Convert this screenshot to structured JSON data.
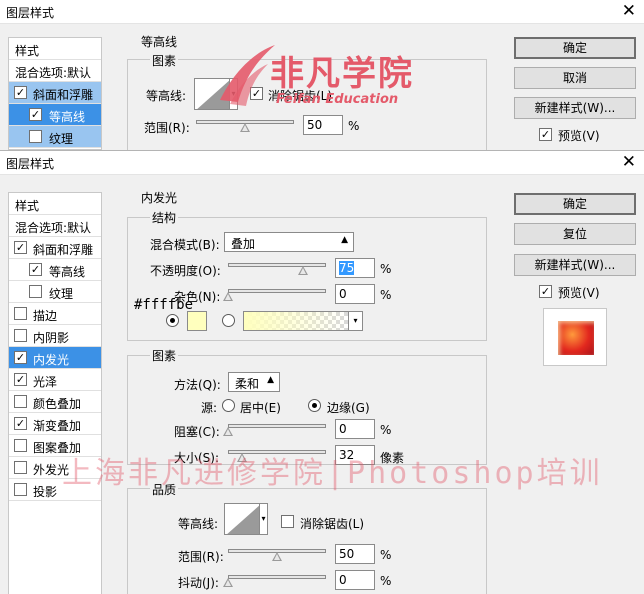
{
  "back_dialog": {
    "title": "图层样式",
    "left_items": [
      {
        "label": "样式"
      },
      {
        "label": "混合选项:默认"
      },
      {
        "label": "斜面和浮雕",
        "checked": "✓"
      },
      {
        "label": "等高线",
        "checked": "✓"
      },
      {
        "label": "纹理",
        "checked": ""
      }
    ],
    "section_title": "等高线",
    "group_title": "图素",
    "contour_label": "等高线:",
    "antialias_label": "消除锯齿(L)",
    "range_label": "范围(R):",
    "range_value": "50",
    "unit": "%",
    "buttons": {
      "ok": "确定",
      "cancel": "取消",
      "new_style": "新建样式(W)...",
      "preview": "预览(V)"
    },
    "logo": {
      "brand": "非凡学院",
      "english": "Feifan Education",
      "color": "#e45a6a"
    }
  },
  "front_dialog": {
    "title": "图层样式",
    "left_items": [
      {
        "label": "样式"
      },
      {
        "label": "混合选项:默认"
      },
      {
        "label": "斜面和浮雕",
        "checked": "✓"
      },
      {
        "label": "等高线",
        "checked": "✓"
      },
      {
        "label": "纹理",
        "checked": ""
      },
      {
        "label": "描边",
        "checked": ""
      },
      {
        "label": "内阴影",
        "checked": ""
      },
      {
        "label": "内发光",
        "checked": "✓",
        "selected": true
      },
      {
        "label": "光泽",
        "checked": "✓"
      },
      {
        "label": "颜色叠加",
        "checked": ""
      },
      {
        "label": "渐变叠加",
        "checked": "✓"
      },
      {
        "label": "图案叠加",
        "checked": ""
      },
      {
        "label": "外发光",
        "checked": ""
      },
      {
        "label": "投影",
        "checked": ""
      }
    ],
    "section_title": "内发光",
    "structure": {
      "title": "结构",
      "blend_mode_label": "混合模式(B):",
      "blend_mode_value": "叠加",
      "opacity_label": "不透明度(O):",
      "opacity_value": "75",
      "opacity_fraction": 0.75,
      "noise_label": "杂色(N):",
      "noise_value": "0",
      "noise_fraction": 0,
      "color_hex": "#ffffbe",
      "unit": "%"
    },
    "elements": {
      "title": "图素",
      "method_label": "方法(Q):",
      "method_value": "柔和",
      "source_label": "源:",
      "source_center": "居中(E)",
      "source_edge": "边缘(G)",
      "choke_label": "阻塞(C):",
      "choke_value": "0",
      "choke_fraction": 0,
      "size_label": "大小(S):",
      "size_value": "32",
      "size_fraction": 0.13,
      "size_unit": "像素",
      "unit": "%"
    },
    "quality": {
      "title": "品质",
      "contour_label": "等高线:",
      "antialias_label": "消除锯齿(L)",
      "range_label": "范围(R):",
      "range_value": "50",
      "range_fraction": 0.5,
      "jitter_label": "抖动(J):",
      "jitter_value": "0",
      "jitter_fraction": 0,
      "unit": "%"
    },
    "buttons": {
      "ok": "确定",
      "reset": "复位",
      "new_style": "新建样式(W)...",
      "preview": "预览(V)"
    }
  },
  "watermark": "上海非凡进修学院|Photoshop培训"
}
